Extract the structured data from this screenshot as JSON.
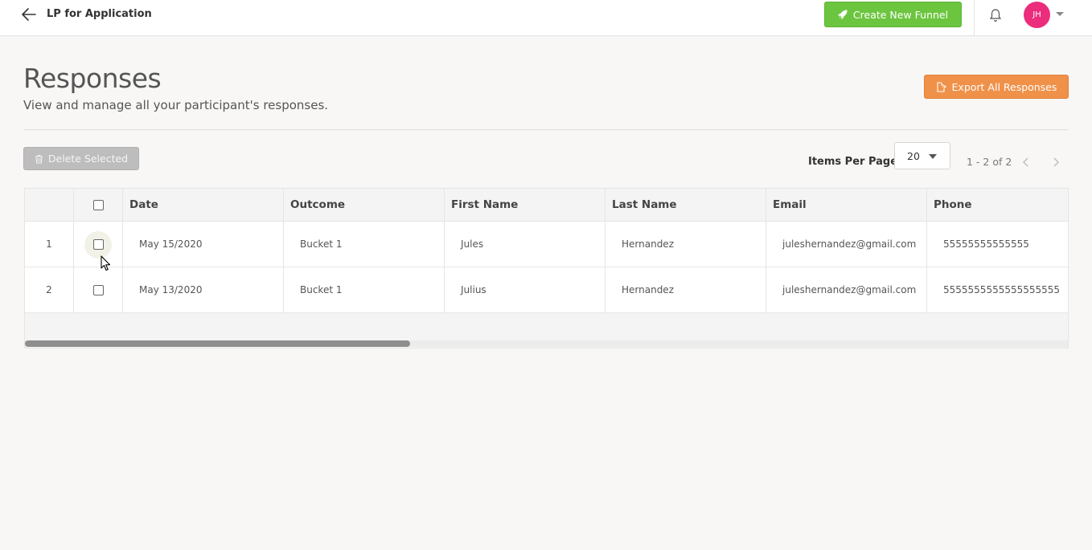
{
  "topbar": {
    "title": "LP for Application",
    "create_label": "Create New Funnel",
    "avatar_initials": "JH"
  },
  "page": {
    "title": "Responses",
    "subtitle": "View and manage all your participant's responses.",
    "export_label": "Export All Responses"
  },
  "toolbar": {
    "delete_label": "Delete Selected",
    "ipp_label": "Items Per Page:",
    "ipp_value": "20",
    "range": "1 - 2 of 2"
  },
  "table": {
    "headers": [
      "Date",
      "Outcome",
      "First Name",
      "Last Name",
      "Email",
      "Phone"
    ],
    "rows": [
      {
        "index": "1",
        "date": "May 15/2020",
        "outcome": "Bucket 1",
        "first": "Jules",
        "last": "Hernandez",
        "email": "juleshernandez@gmail.com",
        "phone": "55555555555555"
      },
      {
        "index": "2",
        "date": "May 13/2020",
        "outcome": "Bucket 1",
        "first": "Julius",
        "last": "Hernandez",
        "email": "juleshernandez@gmail.com",
        "phone": "5555555555555555555"
      }
    ]
  },
  "colors": {
    "create_green": "#6cc53f",
    "export_orange": "#f0914a",
    "avatar_pink": "#ec2c7c",
    "delete_gray": "#bdbdbd"
  },
  "icons": {
    "back": "arrow-left-icon",
    "rocket": "rocket-icon",
    "bell": "bell-icon",
    "export": "export-file-icon",
    "trash": "trash-icon"
  }
}
